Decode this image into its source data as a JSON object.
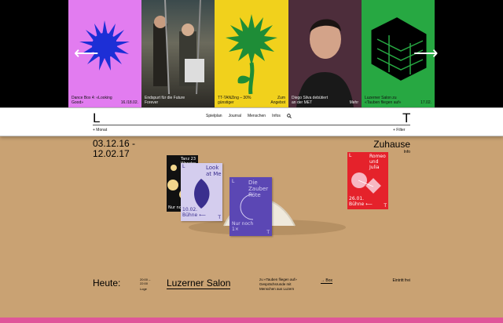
{
  "slider": {
    "prev_icon": "arrow-left-icon",
    "next_icon": "arrow-right-icon",
    "tiles": [
      {
        "caption": "Dance Box 4: «Looking Good»",
        "meta": "16./18.02.",
        "bg": "#e27cf0"
      },
      {
        "caption": "Endspurt für die Future Forever",
        "meta": "",
        "bg": "#6b6a5c"
      },
      {
        "caption": "TT-TANZing – 30% günstiger",
        "meta": "Zum Angebot",
        "bg": "#f1d11c"
      },
      {
        "caption": "Diego Silva debütiert an der MET",
        "meta": "Mehr",
        "bg": "#4d2d3b"
      },
      {
        "caption": "Luzerner Salon zu «Tauben fliegen auf»",
        "meta": "17.02.",
        "bg": "#27a842"
      }
    ]
  },
  "nav": {
    "logo_left": "L",
    "logo_right": "T",
    "links": [
      "Spielplan",
      "Journal",
      "Menschen",
      "Infos"
    ],
    "search_icon": "search-icon",
    "month_label": "+ Monat",
    "filter_label": "+ Filter"
  },
  "hero": {
    "dates": "03.12.16 -\n12.02.17",
    "title": "Zuhause",
    "info": "Info"
  },
  "posters": {
    "tanz": {
      "title": "Tanz 23",
      "subtitle": "Wonder",
      "footer": "Nur noch"
    },
    "look": {
      "title": "Look at Me",
      "date": "10.02.",
      "venue": "Bühne ⟵",
      "corner_l": "L",
      "corner_t": "T"
    },
    "zauber": {
      "title": "Die Zauber flöte",
      "footer": "Nur noch 1×",
      "corner_l": "L",
      "corner_t": "T"
    },
    "romeo": {
      "title": "Romeo und Julia",
      "date": "26.01.",
      "venue": "Bühne ⟵",
      "corner_l": "L",
      "corner_t": "T"
    }
  },
  "today": {
    "label": "Heute:",
    "time": "20:00 –\n22:00",
    "venue_small": "Loge",
    "event": "Luzerner Salon",
    "description": "zu «Tauben fliegen auf» Gesprächsrunde mit Menschen aus Luzern",
    "link": "→ Box",
    "entry": "Eintritt frei"
  }
}
